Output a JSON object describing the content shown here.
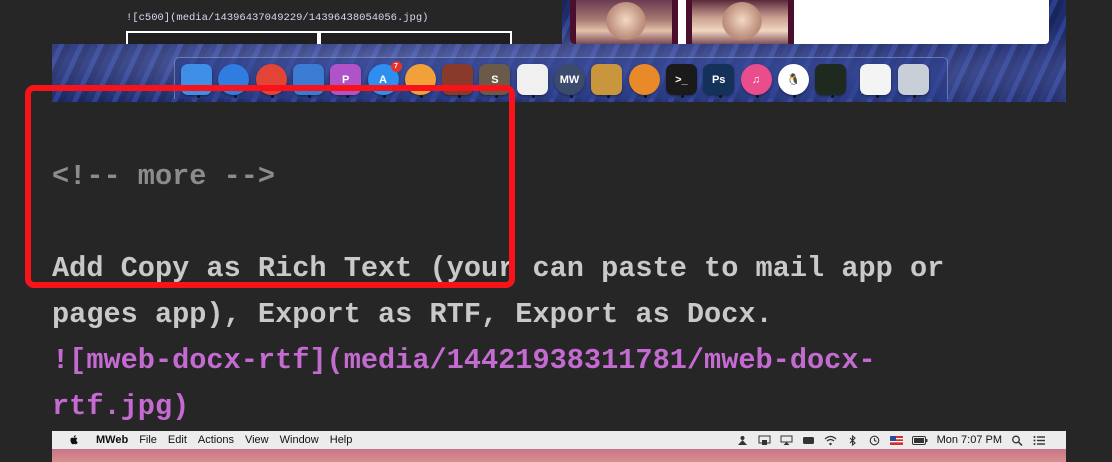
{
  "embedded_top": {
    "markdown_line": "![c500](media/14396437049229/14396438054056.jpg)"
  },
  "dock": {
    "items": [
      {
        "name": "finder-icon",
        "color": "#3f8fe6",
        "glyph": ""
      },
      {
        "name": "safari-icon",
        "color": "#2f7de0",
        "glyph": ""
      },
      {
        "name": "chrome-icon",
        "color": "#e24536",
        "glyph": ""
      },
      {
        "name": "xcode-icon",
        "color": "#3b7bd4",
        "glyph": ""
      },
      {
        "name": "paw-icon",
        "color": "#b052c8",
        "glyph": "P"
      },
      {
        "name": "app-store-icon",
        "color": "#2f8ff0",
        "glyph": "A",
        "badge": "7"
      },
      {
        "name": "photos-icon",
        "color": "#f2a13a",
        "glyph": ""
      },
      {
        "name": "books-icon",
        "color": "#8a3a2a",
        "glyph": ""
      },
      {
        "name": "sublime-text-icon",
        "color": "#6a5a4a",
        "glyph": "S"
      },
      {
        "name": "textedit-icon",
        "color": "#f0f0f0",
        "glyph": ""
      },
      {
        "name": "mweb-icon",
        "color": "#3a4b6b",
        "glyph": "MW"
      },
      {
        "name": "archive-icon",
        "color": "#c9963e",
        "glyph": ""
      },
      {
        "name": "blender-icon",
        "color": "#e88a2a",
        "glyph": ""
      },
      {
        "name": "terminal-icon",
        "color": "#1a1a1a",
        "glyph": ">_"
      },
      {
        "name": "photoshop-icon",
        "color": "#14315a",
        "glyph": "Ps"
      },
      {
        "name": "itunes-icon",
        "color": "#e94d8c",
        "glyph": "♫"
      },
      {
        "name": "qq-icon",
        "color": "#ffffff",
        "glyph": "🐧"
      },
      {
        "name": "activity-monitor-icon",
        "color": "#1d2a1d",
        "glyph": ""
      },
      {
        "name": "document-icon",
        "color": "#f4f4f4",
        "glyph": ""
      },
      {
        "name": "trash-icon",
        "color": "#c9cfd8",
        "glyph": ""
      }
    ]
  },
  "markdown": {
    "comment": "<!-- more -->",
    "text_line_1": "Add Copy as Rich Text (your can paste to mail app or",
    "text_line_2": "pages app), Export as RTF, Export as Docx.",
    "link_line_1": "![mweb-docx-rtf](media/14421938311781/mweb-docx-",
    "link_line_2": "rtf.jpg)"
  },
  "embedded_bottom": {
    "menubar": {
      "app_name": "MWeb",
      "menus": [
        "File",
        "Edit",
        "Actions",
        "View",
        "Window",
        "Help"
      ],
      "clock": "Mon 7:07 PM"
    }
  }
}
